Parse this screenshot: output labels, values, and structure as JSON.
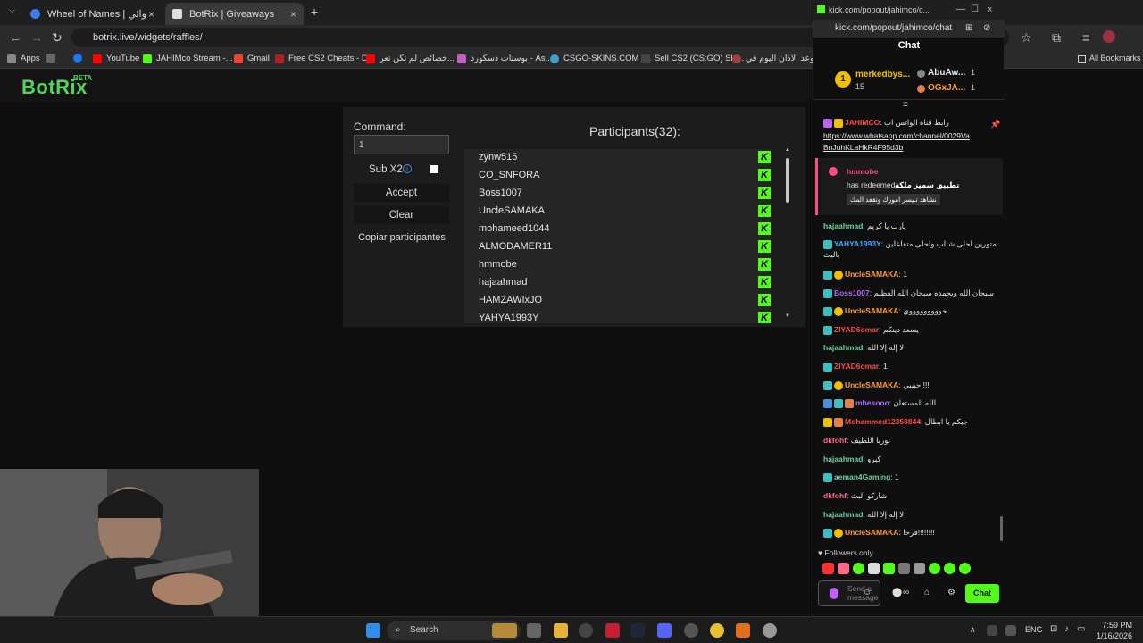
{
  "browser": {
    "tabs": [
      {
        "title": "Wheel of Names | اسم العشوائي",
        "active": false
      },
      {
        "title": "BotRix | Giveaways",
        "active": true
      }
    ],
    "new_tab": "+",
    "url": "botrix.live/widgets/raffles/",
    "bookmarks": [
      "Apps",
      "YouTube",
      "JAHIMco Stream -...",
      "Gmail",
      "Free CS2 Cheats - D...",
      "خصائص لم تكن تعر...",
      "بوستات دسكورد - As...",
      "CSGO-SKINS.COM -...",
      "Sell CS2 (CS:GO) Ski...",
      "موعد الاذان اليوم في..."
    ],
    "all_bookmarks": "All Bookmarks"
  },
  "botrix": {
    "logo": "BotRix",
    "beta": "BETA",
    "command_label": "Command:",
    "command_value": "1",
    "sub_label": "Sub X2",
    "sub_info": "i",
    "accept": "Accept",
    "clear": "Clear",
    "copy": "Copiar participantes",
    "participants_title": "Participants(32):",
    "participants": [
      "zynw515",
      "CO_SNFORA",
      "Boss1007",
      "UncleSAMAKA",
      "mohameed1044",
      "ALMODAMER11",
      "hmmobe",
      "hajaahmad",
      "HAMZAWIxJO",
      "YAHYA1993Y"
    ]
  },
  "kick": {
    "window_title": "kick.com/popout/jahimco/c...",
    "url": "kick.com/popout/jahimco/chat",
    "chat_header": "Chat",
    "leader_name": "merkedbys...",
    "leader_rank": "1",
    "leader_count": "15",
    "top2": [
      {
        "name": "AbuAw...",
        "count": "1"
      },
      {
        "name": "OGxJA...",
        "count": "1"
      }
    ],
    "pinned": {
      "user": "JAHIMCO",
      "text": "رابط قناة الواتس اب",
      "link1": "https://www.whatsapp.com/channel/0029Va",
      "link2": "BnJuhKLaHkR4F95d3b"
    },
    "redeem": {
      "user": "hmmobe",
      "line": "has redeemed",
      "reward": "تطبيق سميز ملكة",
      "sub": "نشاهد تـيسر امورك وتقفد المك"
    },
    "messages": [
      {
        "user": "hajaahmad",
        "color": "#6fcfa0",
        "text": "يارب يا كريم"
      },
      {
        "user": "YAHYA1993Y",
        "color": "#4aa3ff",
        "text": "متورين احلى شباب واحلى متفاعلين",
        "text2": "بالبث"
      },
      {
        "user": "UncleSAMAKA",
        "color": "#ff9a3c",
        "text": "1"
      },
      {
        "user": "Boss1007",
        "color": "#b36bff",
        "text": "سبحان الله وبحمده سبحان الله العظيم"
      },
      {
        "user": "UncleSAMAKA",
        "color": "#ff9a3c",
        "text": "خوووووووووي"
      },
      {
        "user": "ZIYAD6omar",
        "color": "#ff4a4a",
        "text": "يسعد دينكم"
      },
      {
        "user": "hajaahmad",
        "color": "#6fcfa0",
        "text": "لا إله إلا الله"
      },
      {
        "user": "ZIYAD6omar",
        "color": "#ff4a4a",
        "text": "1"
      },
      {
        "user": "UncleSAMAKA",
        "color": "#ff9a3c",
        "text": "حبيبي!!!!"
      },
      {
        "user": "mbesooo",
        "color": "#b36bff",
        "text": "الله المستعان"
      },
      {
        "user": "Mohammed12358844",
        "color": "#ff4a4a",
        "text": "جيكم يا ابطال"
      },
      {
        "user": "dkfohf",
        "color": "#ff6b8b",
        "text": "نوربا اللطيف"
      },
      {
        "user": "hajaahmad",
        "color": "#6fcfa0",
        "text": "كبرو"
      },
      {
        "user": "aeman4Gaming",
        "color": "#6fcfa0",
        "text": "1"
      },
      {
        "user": "dkfohf",
        "color": "#ff6b8b",
        "text": "شاركو البث"
      },
      {
        "user": "hajaahmad",
        "color": "#6fcfa0",
        "text": "لا إله إلا الله"
      },
      {
        "user": "UncleSAMAKA",
        "color": "#ff9a3c",
        "text": "فرحا!!!!!!!!"
      }
    ],
    "followers_only": "Followers only",
    "send_placeholder": "Send a message",
    "chat_button": "Chat"
  },
  "taskbar": {
    "search": "Search",
    "lang": "ENG",
    "time": "7:59 PM",
    "date": "1/16/2026"
  }
}
